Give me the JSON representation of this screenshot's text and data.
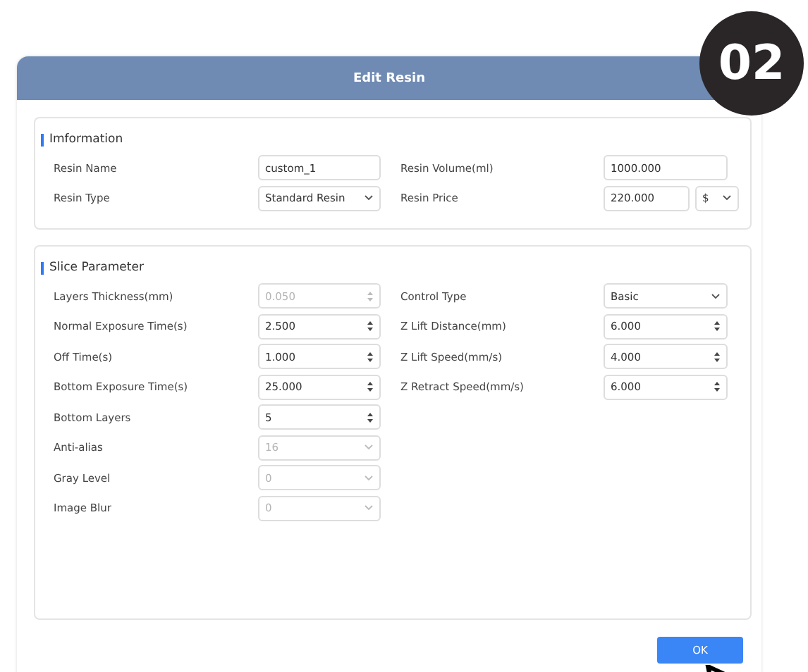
{
  "badge": "02",
  "dialog": {
    "title": "Edit Resin",
    "sections": [
      {
        "title": "Imformation",
        "columns": [
          [
            {
              "label": "Resin Name",
              "kind": "text",
              "value": "custom_1",
              "disabled": false
            },
            {
              "label": "Resin Type",
              "kind": "select",
              "value": "Standard Resin",
              "disabled": false
            }
          ],
          [
            {
              "label": "Resin Volume(ml)",
              "kind": "text",
              "value": "1000.000",
              "disabled": false
            },
            {
              "label": "Resin Price",
              "kind": "price",
              "value": "220.000",
              "currency": "$",
              "disabled": false
            }
          ]
        ]
      },
      {
        "title": "Slice Parameter",
        "columns": [
          [
            {
              "label": "Layers Thickness(mm)",
              "kind": "number",
              "value": "0.050",
              "disabled": true
            },
            {
              "label": "Normal Exposure Time(s)",
              "kind": "number",
              "value": "2.500",
              "disabled": false
            },
            {
              "label": "Off Time(s)",
              "kind": "number",
              "value": "1.000",
              "disabled": false
            },
            {
              "label": "Bottom Exposure Time(s)",
              "kind": "number",
              "value": "25.000",
              "disabled": false
            },
            {
              "label": "Bottom Layers",
              "kind": "number",
              "value": "5",
              "disabled": false
            },
            {
              "label": "Anti-alias",
              "kind": "select",
              "value": "16",
              "disabled": true
            },
            {
              "label": "Gray Level",
              "kind": "select",
              "value": "0",
              "disabled": true
            },
            {
              "label": "Image Blur",
              "kind": "select",
              "value": "0",
              "disabled": true
            }
          ],
          [
            {
              "label": "Control Type",
              "kind": "select",
              "value": "Basic",
              "disabled": false
            },
            {
              "label": "Z Lift Distance(mm)",
              "kind": "number",
              "value": "6.000",
              "disabled": false
            },
            {
              "label": "Z Lift Speed(mm/s)",
              "kind": "number",
              "value": "4.000",
              "disabled": false
            },
            {
              "label": "Z Retract Speed(mm/s)",
              "kind": "number",
              "value": "6.000",
              "disabled": false
            }
          ]
        ]
      }
    ],
    "button": "OK"
  }
}
